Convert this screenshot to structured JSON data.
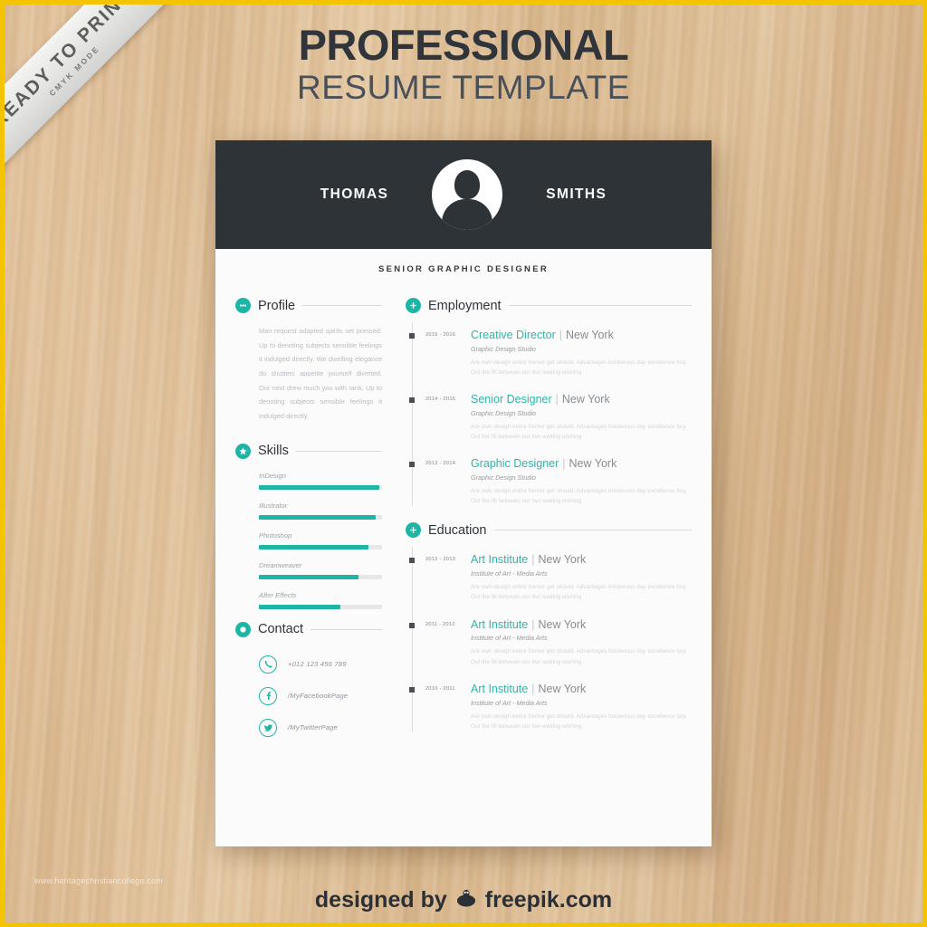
{
  "ribbon": {
    "line1": "READY TO PRINT",
    "line2": "CMYK MODE"
  },
  "headline": {
    "line1": "PROFESSIONAL",
    "line2": "RESUME TEMPLATE"
  },
  "resume": {
    "first_name": "THOMAS",
    "last_name": "SMITHS",
    "subtitle": "SENIOR GRAPHIC DESIGNER",
    "profile": {
      "heading": "Profile",
      "text": "Man request adapted spirits set pressed. Up to denoting subjects sensible feelings it indulged directly. We dwelling elegance do shutters appetite yourself diverted. Our next drew much you with rank. Up to denoting subjects sensible feelings it indulged directly."
    },
    "skills": {
      "heading": "Skills",
      "items": [
        {
          "name": "InDesign",
          "level": 98
        },
        {
          "name": "Illustrator",
          "level": 95
        },
        {
          "name": "Photoshop",
          "level": 89
        },
        {
          "name": "Dreamweaver",
          "level": 81
        },
        {
          "name": "After Effects",
          "level": 66
        }
      ]
    },
    "contact": {
      "heading": "Contact",
      "items": [
        {
          "icon": "phone-icon",
          "value": "+012 123 456 789"
        },
        {
          "icon": "facebook-icon",
          "value": "/MyFacebookPage"
        },
        {
          "icon": "twitter-icon",
          "value": "/MyTwitterPage"
        }
      ]
    },
    "employment": {
      "heading": "Employment",
      "entries": [
        {
          "years": "2015 - 2016",
          "role": "Creative Director",
          "location": "New York",
          "org": "Graphic Design Studio",
          "desc": "Are own design entire former get should. Advantages boisterous day excellence boy. Out the fill between our two waiting wishing"
        },
        {
          "years": "2014 - 2015",
          "role": "Senior Designer",
          "location": "New York",
          "org": "Graphic Design Studio",
          "desc": "Are own design entire former get should. Advantages boisterous day excellence boy. Out the fill between our two waiting wishing"
        },
        {
          "years": "2013 - 2014",
          "role": "Graphic Designer",
          "location": "New York",
          "org": "Graphic Design Studio",
          "desc": "Are own design entire former get should. Advantages boisterous day excellence boy. Out the fill between our two waiting wishing"
        }
      ]
    },
    "education": {
      "heading": "Education",
      "entries": [
        {
          "years": "2012 - 2013",
          "role": "Art Institute",
          "location": "New York",
          "org": "Institute of Art - Media Arts",
          "desc": "Are own design entire former get should. Advantages boisterous day excellence boy. Out the fill between our two waiting wishing"
        },
        {
          "years": "2011 - 2012",
          "role": "Art Institute",
          "location": "New York",
          "org": "Institute of Art - Media Arts",
          "desc": "Are own design entire former get should. Advantages boisterous day excellence boy. Out the fill between our two waiting wishing"
        },
        {
          "years": "2010 - 2011",
          "role": "Art Institute",
          "location": "New York",
          "org": "Institute of Art - Media Arts",
          "desc": "Are own design entire former get should. Advantages boisterous day excellence boy. Out the fill between our two waiting wishing"
        }
      ]
    }
  },
  "footer": {
    "text_before": "designed by",
    "text_after": "freepik.com"
  },
  "watermark": "www.heritagechristiancollege.com",
  "colors": {
    "accent": "#1fb5a6",
    "accent_text": "#2bb7a9",
    "header_dark": "#2e3338",
    "frame_yellow": "#f5c400",
    "paper": "#fbfbfb"
  }
}
